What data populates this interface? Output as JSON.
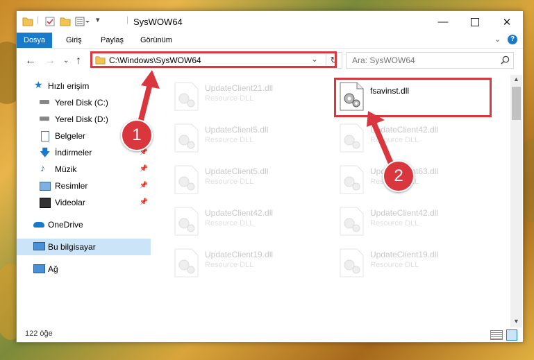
{
  "window": {
    "title": "SysWOW64"
  },
  "ribbon": {
    "tabs": [
      "Dosya",
      "Giriş",
      "Paylaş",
      "Görünüm"
    ]
  },
  "address": {
    "path": "C:\\Windows\\SysWOW64"
  },
  "search": {
    "placeholder": "Ara: SysWOW64"
  },
  "sidebar": {
    "items": [
      {
        "label": "Hızlı erişim"
      },
      {
        "label": "Yerel Disk (C:)"
      },
      {
        "label": "Yerel Disk (D:)"
      },
      {
        "label": "Belgeler"
      },
      {
        "label": "İndirmeler"
      },
      {
        "label": "Müzik"
      },
      {
        "label": "Resimler"
      },
      {
        "label": "Videolar"
      },
      {
        "label": "OneDrive"
      },
      {
        "label": "Bu bilgisayar"
      },
      {
        "label": "Ağ"
      }
    ]
  },
  "files": [
    {
      "name": "UpdateClient21.dll",
      "type": "Resource DLL"
    },
    {
      "name": "fsavinst.dll",
      "type": ""
    },
    {
      "name": "UpdateClient5.dll",
      "type": "Resource DLL"
    },
    {
      "name": "UpdateClient42.dll",
      "type": "Resource DLL"
    },
    {
      "name": "UpdateClient5.dll",
      "type": "Resource DLL"
    },
    {
      "name": "UpdateClient63.dll",
      "type": "Resource DLL"
    },
    {
      "name": "UpdateClient42.dll",
      "type": "Resource DLL"
    },
    {
      "name": "UpdateClient42.dll",
      "type": "Resource DLL"
    },
    {
      "name": "UpdateClient19.dll",
      "type": "Resource DLL"
    },
    {
      "name": "UpdateClient19.dll",
      "type": "Resource DLL"
    }
  ],
  "status": {
    "count": "122 öğe"
  },
  "annotations": {
    "step1": "1",
    "step2": "2"
  },
  "colors": {
    "accent": "#1979ca",
    "highlight": "#d9363e",
    "selection": "#cce4f7"
  }
}
